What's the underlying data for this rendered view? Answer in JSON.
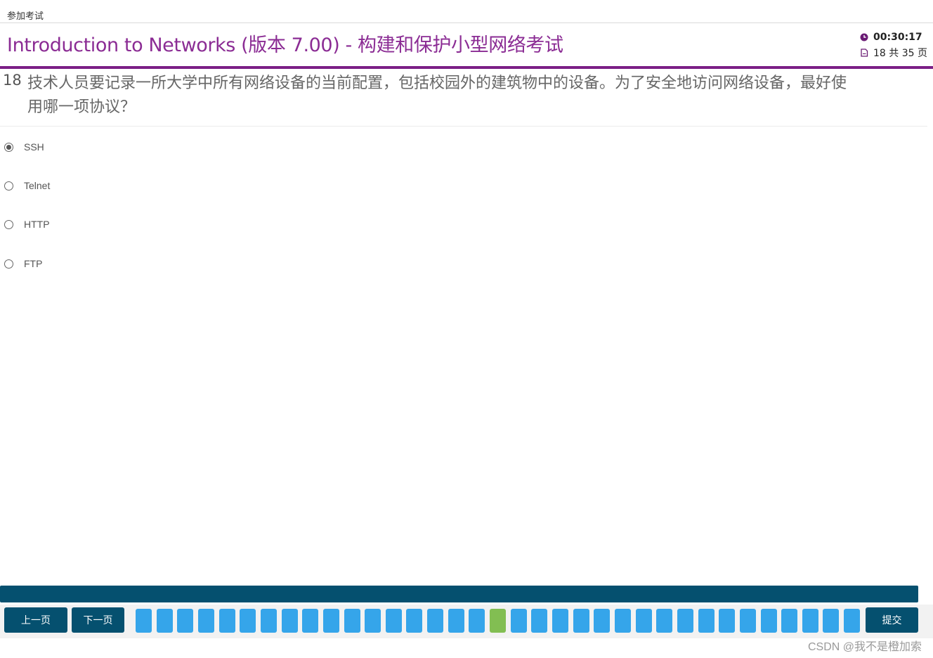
{
  "topbar": {
    "crumb": "参加考试"
  },
  "header": {
    "title": "Introduction to Networks (版本 7.00) - 构建和保护小型网络考试",
    "timer": "00:30:17",
    "page_info": "18 共 35 页"
  },
  "question": {
    "number": "18",
    "text": "技术人员要记录一所大学中所有网络设备的当前配置，包括校园外的建筑物中的设备。为了安全地访问网络设备，最好使用哪一项协议？",
    "options": [
      {
        "label": "SSH",
        "selected": true
      },
      {
        "label": "Telnet",
        "selected": false
      },
      {
        "label": "HTTP",
        "selected": false
      },
      {
        "label": "FTP",
        "selected": false
      }
    ]
  },
  "nav": {
    "prev_label": "上一页",
    "next_label": "下一页",
    "submit_label": "提交",
    "total_pages": 35,
    "current_page": 18
  },
  "watermark": "CSDN @我不是橙加索",
  "colors": {
    "accent_purple": "#8b2c94",
    "nav_dark": "#05506f",
    "tile_blue": "#35a5ea",
    "tile_current": "#82be52"
  },
  "icons": {
    "timer": "clock-icon",
    "pages": "document-icon"
  }
}
